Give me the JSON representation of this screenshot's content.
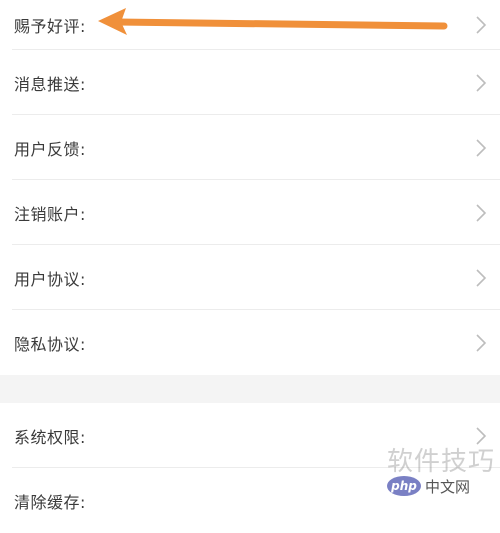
{
  "settings": {
    "items": [
      {
        "label": "赐予好评:"
      },
      {
        "label": "消息推送:"
      },
      {
        "label": "用户反馈:"
      },
      {
        "label": "注销账户:"
      },
      {
        "label": "用户协议:"
      },
      {
        "label": "隐私协议:"
      }
    ],
    "items2": [
      {
        "label": "系统权限:"
      },
      {
        "label": "清除缓存:"
      }
    ]
  },
  "annotation": {
    "color": "#f0903a",
    "icon": "arrow-left-icon"
  },
  "watermark": {
    "text": "软件技巧",
    "logo_badge": "php",
    "logo_text": "中文网"
  },
  "colors": {
    "background": "#f4f4f4",
    "row_background": "#ffffff",
    "label_text": "#3a3a3a",
    "chevron": "#bdbdbd"
  }
}
